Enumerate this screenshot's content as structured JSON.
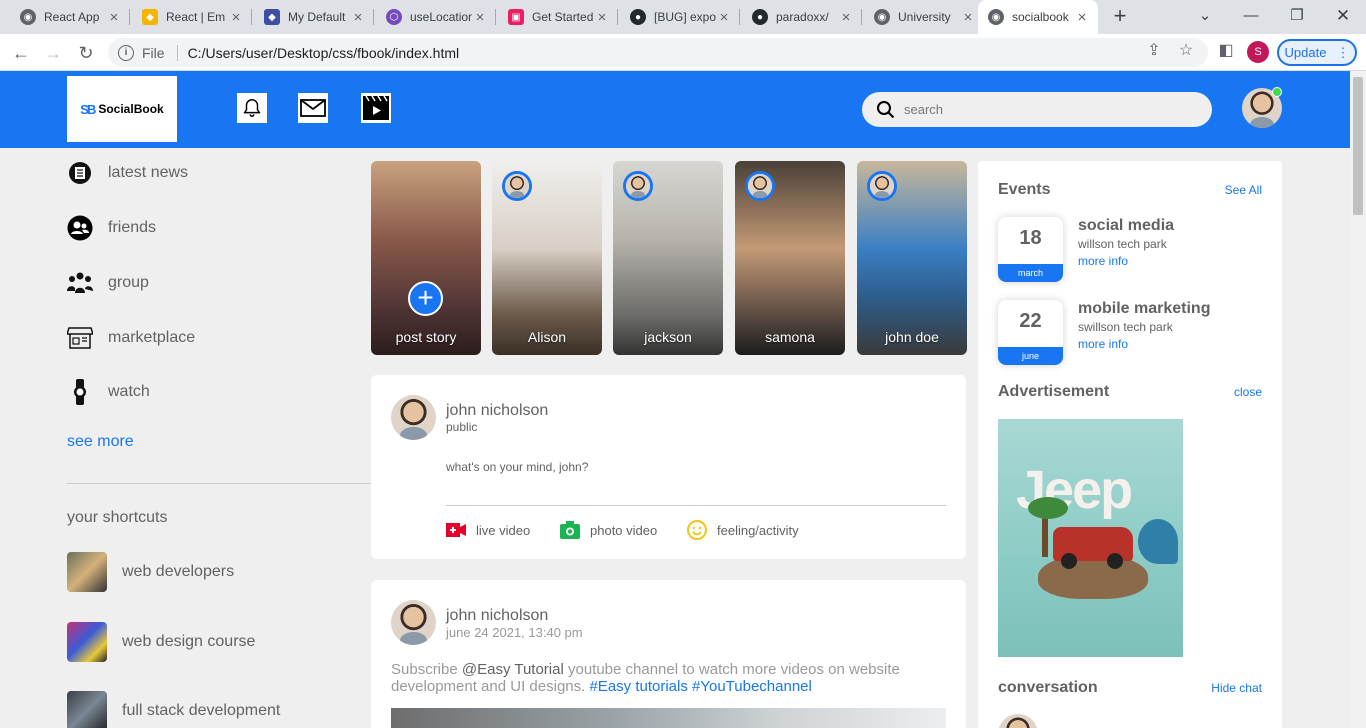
{
  "browser": {
    "tabs": [
      {
        "label": "React App",
        "color": "#5f6368",
        "glyph": "◉"
      },
      {
        "label": "React | Em",
        "color": "#f4b400",
        "glyph": "◆"
      },
      {
        "label": "My Default",
        "color": "#3c4fa3",
        "glyph": "◆"
      },
      {
        "label": "useLocation",
        "color": "#764abc",
        "glyph": "⬡"
      },
      {
        "label": "Get Started",
        "color": "#e91e63",
        "glyph": "▣"
      },
      {
        "label": "[BUG] expo",
        "color": "#24292e",
        "glyph": "●"
      },
      {
        "label": "paradoxx/",
        "color": "#24292e",
        "glyph": "●"
      },
      {
        "label": "University",
        "color": "#5f6368",
        "glyph": "◉"
      },
      {
        "label": "socialbook",
        "color": "#5f6368",
        "glyph": "◉"
      }
    ],
    "address": {
      "scheme": "File",
      "url": "C:/Users/user/Desktop/css/fbook/index.html"
    },
    "profile_initial": "S",
    "update_label": "Update"
  },
  "nav": {
    "logo_text": "SocialBook",
    "logo_mark": "SB",
    "search_placeholder": "search",
    "accent": "#1876f2"
  },
  "left": {
    "items": [
      {
        "label": "latest news",
        "icon": "newspaper-icon"
      },
      {
        "label": "friends",
        "icon": "friends-icon"
      },
      {
        "label": "group",
        "icon": "group-icon"
      },
      {
        "label": "marketplace",
        "icon": "marketplace-icon"
      },
      {
        "label": "watch",
        "icon": "watch-icon"
      }
    ],
    "see_more": "see more",
    "shortcuts_title": "your shortcuts",
    "shortcuts": [
      {
        "label": "web developers"
      },
      {
        "label": "web design course"
      },
      {
        "label": "full stack development"
      }
    ]
  },
  "stories": [
    {
      "label": "post story"
    },
    {
      "label": "Alison"
    },
    {
      "label": "jackson"
    },
    {
      "label": "samona"
    },
    {
      "label": "john doe"
    }
  ],
  "create_post": {
    "user": "john nicholson",
    "visibility": "public",
    "prompt": "what's on your mind, john?",
    "actions": [
      {
        "label": "live video",
        "icon": "live-video-icon"
      },
      {
        "label": "photo video",
        "icon": "photo-icon"
      },
      {
        "label": "feeling/activity",
        "icon": "feeling-icon"
      }
    ]
  },
  "post": {
    "user": "john nicholson",
    "date": "june 24 2021, 13:40 pm",
    "text_before": "Subscribe ",
    "mention": "@Easy Tutorial",
    "text_middle": " youtube channel to watch more videos on website development and UI designs. ",
    "tags": "#Easy tutorials #YouTubechannel"
  },
  "right": {
    "events_title": "Events",
    "see_all": "See All",
    "events": [
      {
        "day": "18",
        "month": "march",
        "title": "social media",
        "place": "willson tech park",
        "more": "more info"
      },
      {
        "day": "22",
        "month": "june",
        "title": "mobile marketing",
        "place": "swillson tech park",
        "more": "more info"
      }
    ],
    "ad_title": "Advertisement",
    "ad_close": "close",
    "ad_brand": "Jeep",
    "conversation_title": "conversation",
    "hide_chat": "Hide chat"
  }
}
